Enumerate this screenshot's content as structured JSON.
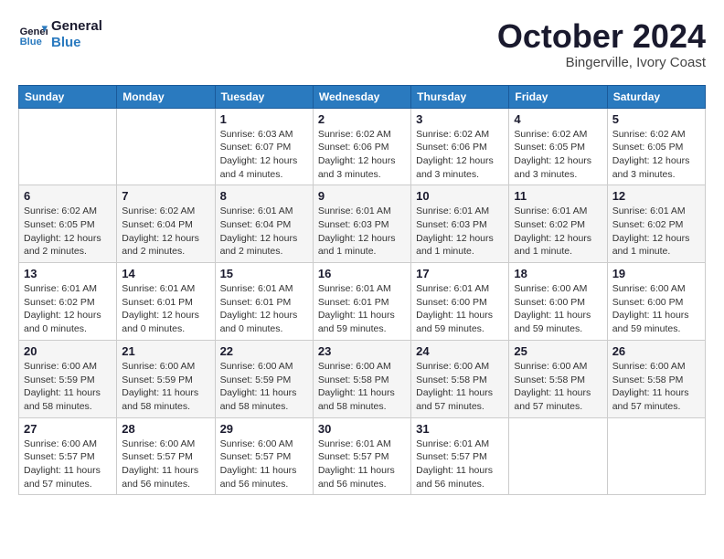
{
  "header": {
    "logo_line1": "General",
    "logo_line2": "Blue",
    "month_title": "October 2024",
    "location": "Bingerville, Ivory Coast"
  },
  "weekdays": [
    "Sunday",
    "Monday",
    "Tuesday",
    "Wednesday",
    "Thursday",
    "Friday",
    "Saturday"
  ],
  "weeks": [
    [
      {
        "day": "",
        "info": ""
      },
      {
        "day": "",
        "info": ""
      },
      {
        "day": "1",
        "info": "Sunrise: 6:03 AM\nSunset: 6:07 PM\nDaylight: 12 hours and 4 minutes."
      },
      {
        "day": "2",
        "info": "Sunrise: 6:02 AM\nSunset: 6:06 PM\nDaylight: 12 hours and 3 minutes."
      },
      {
        "day": "3",
        "info": "Sunrise: 6:02 AM\nSunset: 6:06 PM\nDaylight: 12 hours and 3 minutes."
      },
      {
        "day": "4",
        "info": "Sunrise: 6:02 AM\nSunset: 6:05 PM\nDaylight: 12 hours and 3 minutes."
      },
      {
        "day": "5",
        "info": "Sunrise: 6:02 AM\nSunset: 6:05 PM\nDaylight: 12 hours and 3 minutes."
      }
    ],
    [
      {
        "day": "6",
        "info": "Sunrise: 6:02 AM\nSunset: 6:05 PM\nDaylight: 12 hours and 2 minutes."
      },
      {
        "day": "7",
        "info": "Sunrise: 6:02 AM\nSunset: 6:04 PM\nDaylight: 12 hours and 2 minutes."
      },
      {
        "day": "8",
        "info": "Sunrise: 6:01 AM\nSunset: 6:04 PM\nDaylight: 12 hours and 2 minutes."
      },
      {
        "day": "9",
        "info": "Sunrise: 6:01 AM\nSunset: 6:03 PM\nDaylight: 12 hours and 1 minute."
      },
      {
        "day": "10",
        "info": "Sunrise: 6:01 AM\nSunset: 6:03 PM\nDaylight: 12 hours and 1 minute."
      },
      {
        "day": "11",
        "info": "Sunrise: 6:01 AM\nSunset: 6:02 PM\nDaylight: 12 hours and 1 minute."
      },
      {
        "day": "12",
        "info": "Sunrise: 6:01 AM\nSunset: 6:02 PM\nDaylight: 12 hours and 1 minute."
      }
    ],
    [
      {
        "day": "13",
        "info": "Sunrise: 6:01 AM\nSunset: 6:02 PM\nDaylight: 12 hours and 0 minutes."
      },
      {
        "day": "14",
        "info": "Sunrise: 6:01 AM\nSunset: 6:01 PM\nDaylight: 12 hours and 0 minutes."
      },
      {
        "day": "15",
        "info": "Sunrise: 6:01 AM\nSunset: 6:01 PM\nDaylight: 12 hours and 0 minutes."
      },
      {
        "day": "16",
        "info": "Sunrise: 6:01 AM\nSunset: 6:01 PM\nDaylight: 11 hours and 59 minutes."
      },
      {
        "day": "17",
        "info": "Sunrise: 6:01 AM\nSunset: 6:00 PM\nDaylight: 11 hours and 59 minutes."
      },
      {
        "day": "18",
        "info": "Sunrise: 6:00 AM\nSunset: 6:00 PM\nDaylight: 11 hours and 59 minutes."
      },
      {
        "day": "19",
        "info": "Sunrise: 6:00 AM\nSunset: 6:00 PM\nDaylight: 11 hours and 59 minutes."
      }
    ],
    [
      {
        "day": "20",
        "info": "Sunrise: 6:00 AM\nSunset: 5:59 PM\nDaylight: 11 hours and 58 minutes."
      },
      {
        "day": "21",
        "info": "Sunrise: 6:00 AM\nSunset: 5:59 PM\nDaylight: 11 hours and 58 minutes."
      },
      {
        "day": "22",
        "info": "Sunrise: 6:00 AM\nSunset: 5:59 PM\nDaylight: 11 hours and 58 minutes."
      },
      {
        "day": "23",
        "info": "Sunrise: 6:00 AM\nSunset: 5:58 PM\nDaylight: 11 hours and 58 minutes."
      },
      {
        "day": "24",
        "info": "Sunrise: 6:00 AM\nSunset: 5:58 PM\nDaylight: 11 hours and 57 minutes."
      },
      {
        "day": "25",
        "info": "Sunrise: 6:00 AM\nSunset: 5:58 PM\nDaylight: 11 hours and 57 minutes."
      },
      {
        "day": "26",
        "info": "Sunrise: 6:00 AM\nSunset: 5:58 PM\nDaylight: 11 hours and 57 minutes."
      }
    ],
    [
      {
        "day": "27",
        "info": "Sunrise: 6:00 AM\nSunset: 5:57 PM\nDaylight: 11 hours and 57 minutes."
      },
      {
        "day": "28",
        "info": "Sunrise: 6:00 AM\nSunset: 5:57 PM\nDaylight: 11 hours and 56 minutes."
      },
      {
        "day": "29",
        "info": "Sunrise: 6:00 AM\nSunset: 5:57 PM\nDaylight: 11 hours and 56 minutes."
      },
      {
        "day": "30",
        "info": "Sunrise: 6:01 AM\nSunset: 5:57 PM\nDaylight: 11 hours and 56 minutes."
      },
      {
        "day": "31",
        "info": "Sunrise: 6:01 AM\nSunset: 5:57 PM\nDaylight: 11 hours and 56 minutes."
      },
      {
        "day": "",
        "info": ""
      },
      {
        "day": "",
        "info": ""
      }
    ]
  ]
}
